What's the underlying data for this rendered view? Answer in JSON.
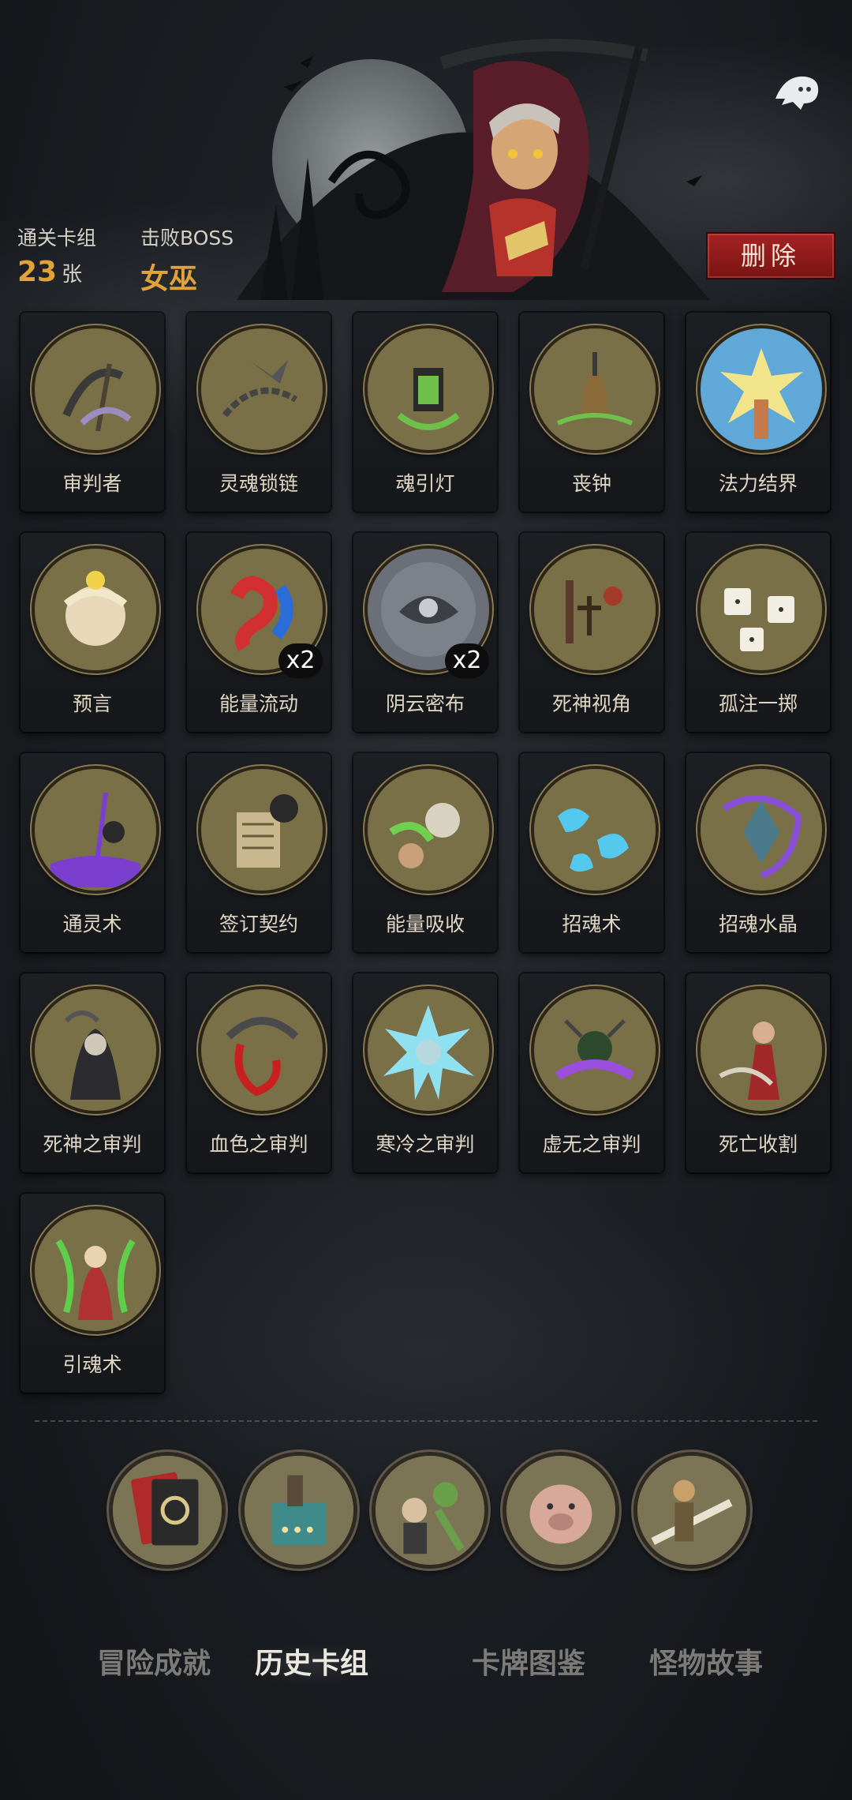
{
  "header": {
    "deck_label": "通关卡组",
    "deck_count": "23",
    "deck_unit": "张",
    "boss_label": "击败BOSS",
    "boss_name": "女巫",
    "delete_label": "删除"
  },
  "cards": [
    {
      "name": "审判者",
      "icon": "scythe-icon",
      "color": "#7a7047",
      "accent": "#9d8cc0"
    },
    {
      "name": "灵魂锁链",
      "icon": "chain-icon",
      "color": "#7a7047",
      "accent": "#555a5e"
    },
    {
      "name": "魂引灯",
      "icon": "lantern-icon",
      "color": "#7a7047",
      "accent": "#6fc04a"
    },
    {
      "name": "丧钟",
      "icon": "bell-icon",
      "color": "#7a7047",
      "accent": "#8b6a3a"
    },
    {
      "name": "法力结界",
      "icon": "burst-icon",
      "color": "#5fa8d8",
      "accent": "#f2e48a"
    },
    {
      "name": "预言",
      "icon": "prophet-icon",
      "color": "#7a7047",
      "accent": "#f0e8c8"
    },
    {
      "name": "能量流动",
      "icon": "yin-yang-icon",
      "color": "#7a7047",
      "accent": "#d23030",
      "multiplier": "x2"
    },
    {
      "name": "阴云密布",
      "icon": "storm-cloud-icon",
      "color": "#6b7078",
      "accent": "#3c4046",
      "multiplier": "x2"
    },
    {
      "name": "死神视角",
      "icon": "graveyard-icon",
      "color": "#7a7047",
      "accent": "#a33a2a"
    },
    {
      "name": "孤注一掷",
      "icon": "dice-icon",
      "color": "#7a7047",
      "accent": "#f2eee4"
    },
    {
      "name": "通灵术",
      "icon": "necromancy-icon",
      "color": "#7a7047",
      "accent": "#7a3fcf"
    },
    {
      "name": "签订契约",
      "icon": "contract-icon",
      "color": "#7a7047",
      "accent": "#c9b78e"
    },
    {
      "name": "能量吸收",
      "icon": "absorb-icon",
      "color": "#7a7047",
      "accent": "#6fd050"
    },
    {
      "name": "招魂术",
      "icon": "summon-icon",
      "color": "#7a7047",
      "accent": "#55c8ee"
    },
    {
      "name": "招魂水晶",
      "icon": "crystal-icon",
      "color": "#7a7047",
      "accent": "#8a4fd8"
    },
    {
      "name": "死神之审判",
      "icon": "reaper-icon",
      "color": "#7a7047",
      "accent": "#2b2b30"
    },
    {
      "name": "血色之审判",
      "icon": "blood-scythe-icon",
      "color": "#7a7047",
      "accent": "#c82020"
    },
    {
      "name": "寒冷之审判",
      "icon": "ice-icon",
      "color": "#7a7047",
      "accent": "#8fe0f0"
    },
    {
      "name": "虚无之审判",
      "icon": "void-icon",
      "color": "#7a7047",
      "accent": "#9a4fdc"
    },
    {
      "name": "死亡收割",
      "icon": "harvest-icon",
      "color": "#7a7047",
      "accent": "#a02828"
    },
    {
      "name": "引魂术",
      "icon": "soul-guide-icon",
      "color": "#7a7047",
      "accent": "#5ecf4a"
    }
  ],
  "categories": [
    {
      "icon": "card-deck-icon",
      "accent": "#b02a2a"
    },
    {
      "icon": "card-achievement-icon",
      "accent": "#3f8a8a"
    },
    {
      "icon": "story-scene-icon",
      "accent": "#6aa04a"
    },
    {
      "icon": "pig-monster-icon",
      "accent": "#d8a89a"
    },
    {
      "icon": "swordsman-icon",
      "accent": "#c9a06a"
    }
  ],
  "tabs": [
    {
      "label": "冒险成就",
      "active": false
    },
    {
      "label": "历史卡组",
      "active": true
    },
    {
      "label": "卡牌图鉴",
      "active": false
    },
    {
      "label": "怪物故事",
      "active": false
    }
  ]
}
